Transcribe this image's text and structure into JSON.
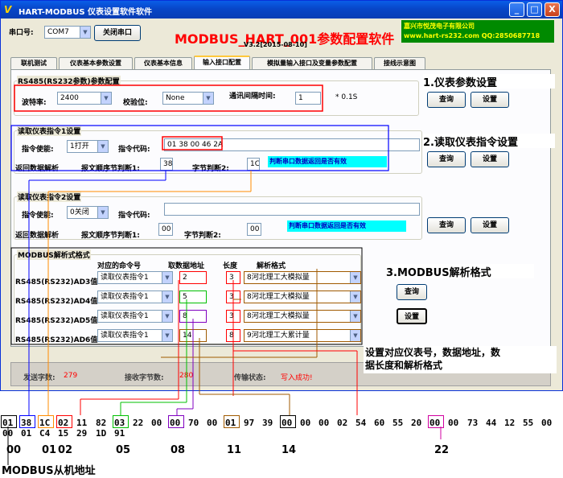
{
  "window": {
    "title": "HART-MODBUS 仪表设置软件软件",
    "icon_glyph": "V",
    "minimize": "_",
    "maximize": "□",
    "close": "X"
  },
  "header": {
    "port_label": "串口号:",
    "port_value": "COM7",
    "close_port_button": "关闭串口",
    "app_title": "MODBUS_HART_001参数配置软件",
    "version": "V3.2[2015-08-10]",
    "company_name": "嘉兴市悦茂电子有限公司",
    "company_contact": "www.hart-rs232.com QQ:2850687718"
  },
  "tabs": [
    "联机测试",
    "仪表基本参数设置",
    "仪表基本信息",
    "输入接口配置",
    "模拟量输入接口及变量参数配置",
    "接线示意图"
  ],
  "active_tab": "输入接口配置",
  "rs485_group": {
    "title": "RS485(RS232参数)参数配置",
    "baud_label": "波特率:",
    "baud_value": "2400",
    "parity_label": "校验位:",
    "parity_value": "None",
    "interval_label": "通讯间隔时间:",
    "interval_value": "1",
    "interval_unit": "* 0.1S",
    "query_button": "查询",
    "set_button": "设置"
  },
  "cmd1_group": {
    "title": "读取仪表指令1设置",
    "enable_label": "指令使能:",
    "enable_value": "1打开",
    "code_label": "指令代码:",
    "code_value": "01 38 00 46 2A",
    "parse_label": "返回数据解析",
    "order1_label": "报文顺序节判断1:",
    "order1_value": "38",
    "order2_label": "字节判断2:",
    "order2_value": "1C",
    "check_note": "判断串口数据返回是否有效",
    "query_button": "查询",
    "set_button": "设置"
  },
  "cmd2_group": {
    "title": "读取仪表指令2设置",
    "enable_label": "指令使能:",
    "enable_value": "0关闭",
    "code_label": "指令代码:",
    "code_value": "",
    "parse_label": "返回数据解析",
    "order1_label": "报文顺序节判断1:",
    "order1_value": "00",
    "order2_label": "字节判断2:",
    "order2_value": "00",
    "check_note": "判断串口数据返回是否有效",
    "query_button": "查询",
    "set_button": "设置"
  },
  "modbus_group": {
    "title": "MODBUS解析式格式",
    "col_cmd": "对应的命令号",
    "col_addr": "取数据地址",
    "col_len": "长度",
    "col_fmt": "解析格式",
    "rows": [
      {
        "label": "RS485(RS232)AD3值:",
        "cmd": "读取仪表指令1",
        "addr": "2",
        "len": "3",
        "fmt": "8河北理工大模拟量"
      },
      {
        "label": "RS485(RS232)AD4值:",
        "cmd": "读取仪表指令1",
        "addr": "5",
        "len": "3",
        "fmt": "8河北理工大模拟量"
      },
      {
        "label": "RS485(RS232)AD5值:",
        "cmd": "读取仪表指令1",
        "addr": "8",
        "len": "3",
        "fmt": "8河北理工大模拟量"
      },
      {
        "label": "RS485(RS232)AD6值:",
        "cmd": "读取仪表指令1",
        "addr": "14",
        "len": "8",
        "fmt": "9河北理工大累计量"
      }
    ],
    "query_button": "查询",
    "set_button": "设置"
  },
  "status": {
    "sent_label": "发送字数:",
    "sent_value": "279",
    "recv_label": "接收字节数:",
    "recv_value": "280",
    "state_label": "传输状态:",
    "state_value": "写入成功!"
  },
  "annotations": {
    "a1": "1.仪表参数设置",
    "a2": "2.读取仪表指令设置",
    "a3": "3.MODBUS解析格式",
    "a4_line1": "设置对应仪表号，数据地址，数",
    "a4_line2": "据长度和解析格式"
  },
  "hex": {
    "row1": [
      "01",
      "38",
      "1C",
      "02",
      "11",
      "82",
      "03",
      "22",
      "00",
      "00",
      "70",
      "00",
      "01",
      "97",
      "39",
      "00",
      "00",
      "00",
      "02",
      "54",
      "60",
      "55",
      "20",
      "00",
      "00",
      "73",
      "44",
      "12",
      "55",
      "00"
    ],
    "row2": [
      "00",
      "01",
      "C4",
      "15",
      "29",
      "1D",
      "91"
    ],
    "index_labels": [
      "00",
      "01",
      "02",
      "05",
      "08",
      "11",
      "14",
      "22"
    ],
    "slave_address_label": "MODBUS从机地址"
  },
  "colors": {
    "red": "#ff0000",
    "blue": "#0000ff",
    "orange": "#ff8c00",
    "green": "#00c000",
    "purple": "#8000c0",
    "brown": "#a05a00",
    "magenta": "#d000a0"
  }
}
